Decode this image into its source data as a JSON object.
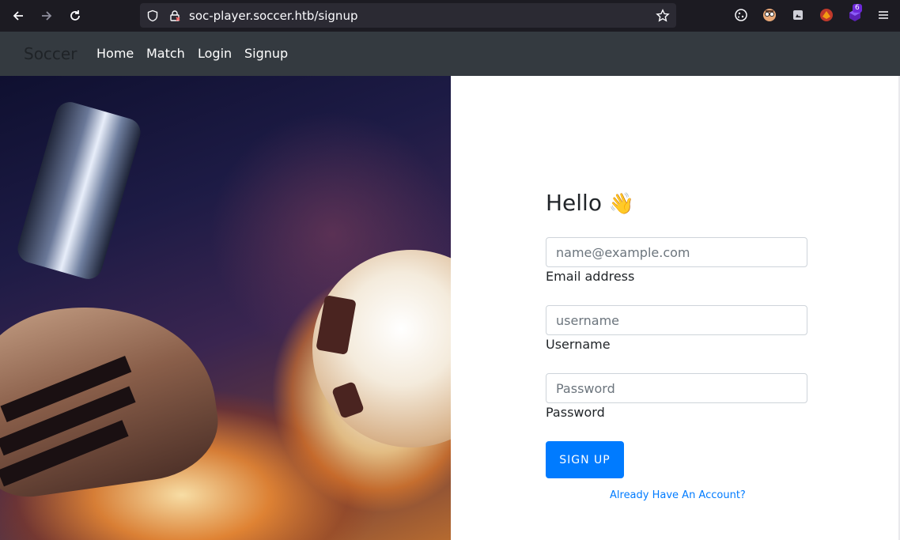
{
  "browser": {
    "url": "soc-player.soccer.htb/signup",
    "extension_badge": "6",
    "icons": [
      "back-arrow-icon",
      "forward-arrow-icon",
      "reload-icon",
      "shield-icon",
      "lock-icon",
      "star-icon",
      "cookie-icon",
      "glasses-icon",
      "puzzle-icon",
      "fox-icon",
      "cube-icon",
      "hamburger-menu-icon"
    ]
  },
  "navbar": {
    "brand": "Soccer",
    "links": [
      "Home",
      "Match",
      "Login",
      "Signup"
    ]
  },
  "form": {
    "greeting": "Hello",
    "greeting_emoji": "👋",
    "email_placeholder": "name@example.com",
    "email_label": "Email address",
    "username_placeholder": "username",
    "username_label": "Username",
    "password_placeholder": "Password",
    "password_label": "Password",
    "submit_label": "SIGN UP",
    "account_link": "Already Have An Account?"
  },
  "colors": {
    "primary": "#007bff",
    "navbar_bg": "#343a40",
    "browser_bg": "#1c1b22"
  }
}
